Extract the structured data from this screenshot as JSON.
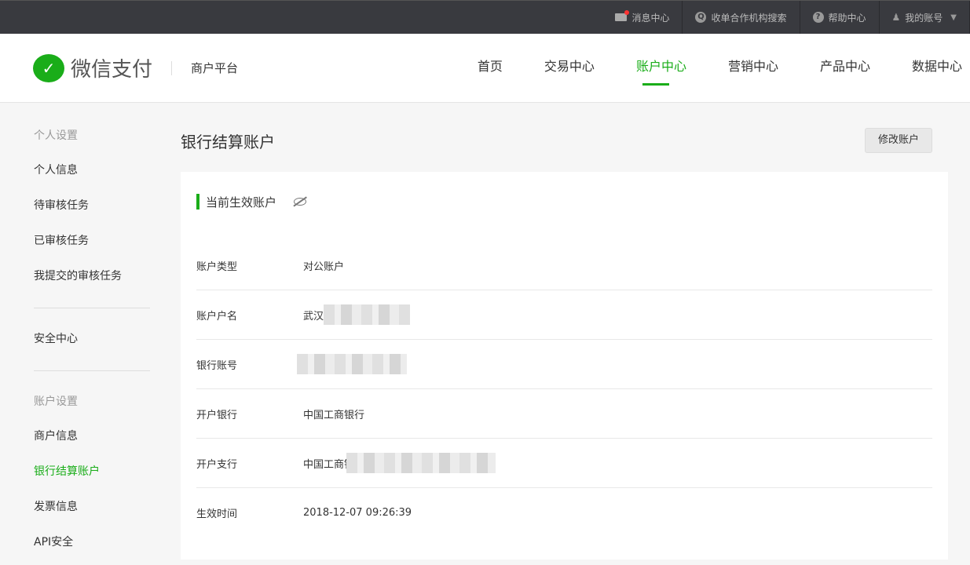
{
  "topbar": {
    "items": [
      {
        "label": "消息中心",
        "icon": "mail-icon"
      },
      {
        "label": "收单合作机构搜索",
        "icon": "search-icon"
      },
      {
        "label": "帮助中心",
        "icon": "help-icon"
      },
      {
        "label": "我的账号",
        "icon": "user-icon"
      }
    ]
  },
  "header": {
    "logo": "微信支付",
    "subtitle": "商户平台",
    "nav": [
      "首页",
      "交易中心",
      "账户中心",
      "营销中心",
      "产品中心",
      "数据中心"
    ]
  },
  "sidebar": {
    "group1": "个人设置",
    "items1": [
      "个人信息",
      "待审核任务",
      "已审核任务",
      "我提交的审核任务"
    ],
    "security": "安全中心",
    "group2": "账户设置",
    "items2": [
      "商户信息",
      "银行结算账户",
      "发票信息",
      "API安全"
    ]
  },
  "main": {
    "title": "银行结算账户",
    "edit_button": "修改账户",
    "section": "当前生效账户",
    "rows": [
      {
        "label": "账户类型",
        "value": "对公账户"
      },
      {
        "label": "账户户名",
        "value": "武汉"
      },
      {
        "label": "银行账号",
        "value": ""
      },
      {
        "label": "开户银行",
        "value": "中国工商银行"
      },
      {
        "label": "开户支行",
        "value": "中国工商银"
      },
      {
        "label": "生效时间",
        "value": "2018-12-07 09:26:39"
      }
    ]
  },
  "colors": {
    "accent": "#1aad19",
    "topbar": "#393a3f"
  }
}
